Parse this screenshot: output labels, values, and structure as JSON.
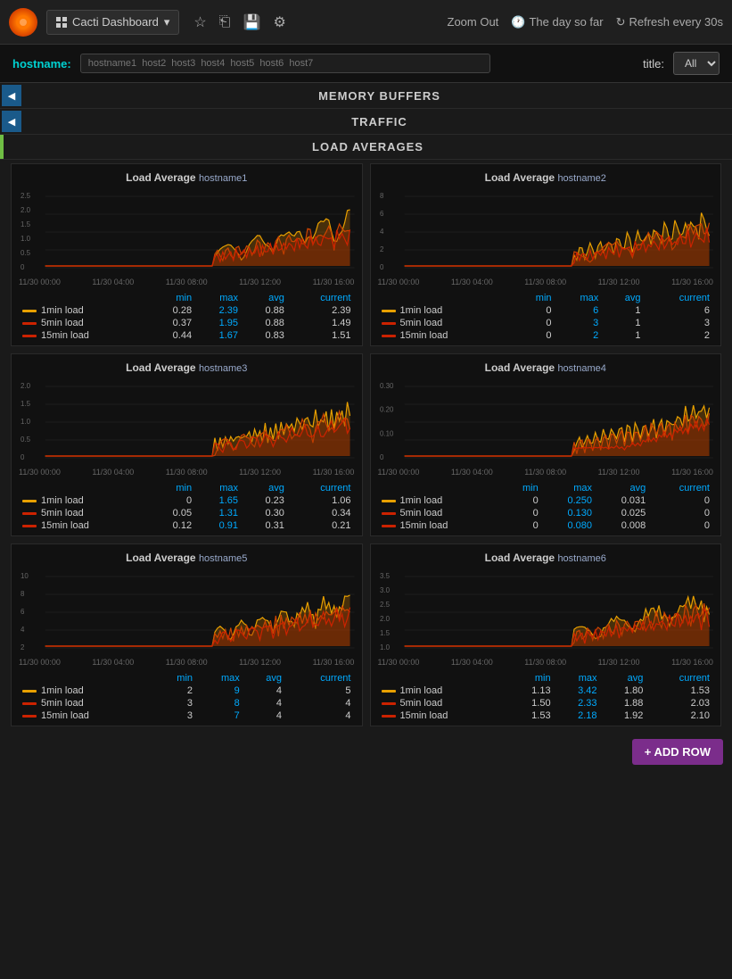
{
  "topbar": {
    "title": "Cacti Dashboard",
    "dropdown_arrow": "▾",
    "icons": [
      "☆",
      "⎋",
      "💾",
      "⚙"
    ],
    "zoom_out": "Zoom Out",
    "time_range": "The day so far",
    "refresh": "Refresh every 30s"
  },
  "filterbar": {
    "hostname_label": "hostname:",
    "hostname_value": "",
    "hostname_placeholder": "hostname1  host2  host3  host4  host5  host6  host7",
    "title_label": "title:",
    "title_value": "All"
  },
  "sections": [
    {
      "label": "MEMORY BUFFERS"
    },
    {
      "label": "TRAFFIC"
    },
    {
      "label": "LOAD AVERAGES"
    }
  ],
  "charts": [
    {
      "id": "chart1",
      "title": "Load Average",
      "hostname": "hostname1",
      "ymax": 2.5,
      "yticks": [
        "2.5",
        "2.0",
        "1.5",
        "1.0",
        "0.5",
        "0"
      ],
      "xLabels": [
        "11/30 00:00",
        "11/30 04:00",
        "11/30 08:00",
        "11/30 12:00",
        "11/30 16:00"
      ],
      "stats": [
        {
          "label": "1min load",
          "color": "#e8a000",
          "min": "0.28",
          "max": "2.39",
          "avg": "0.88",
          "current": "2.39"
        },
        {
          "label": "5min load",
          "color": "#cc2200",
          "min": "0.37",
          "max": "1.95",
          "avg": "0.88",
          "current": "1.49"
        },
        {
          "label": "15min load",
          "color": "#cc2200",
          "min": "0.44",
          "max": "1.67",
          "avg": "0.83",
          "current": "1.51"
        }
      ]
    },
    {
      "id": "chart2",
      "title": "Load Average",
      "hostname": "hostname2",
      "ymax": 8,
      "yticks": [
        "8",
        "6",
        "4",
        "2",
        "0"
      ],
      "xLabels": [
        "11/30 00:00",
        "11/30 04:00",
        "11/30 08:00",
        "11/30 12:00",
        "11/30 16:00"
      ],
      "stats": [
        {
          "label": "1min load",
          "color": "#e8a000",
          "min": "0",
          "max": "6",
          "avg": "1",
          "current": "6"
        },
        {
          "label": "5min load",
          "color": "#cc2200",
          "min": "0",
          "max": "3",
          "avg": "1",
          "current": "3"
        },
        {
          "label": "15min load",
          "color": "#cc2200",
          "min": "0",
          "max": "2",
          "avg": "1",
          "current": "2"
        }
      ]
    },
    {
      "id": "chart3",
      "title": "Load Average",
      "hostname": "hostname3",
      "ymax": 2.0,
      "yticks": [
        "2.0",
        "1.5",
        "1.0",
        "0.5",
        "0"
      ],
      "xLabels": [
        "11/30 00:00",
        "11/30 04:00",
        "11/30 08:00",
        "11/30 12:00",
        "11/30 16:00"
      ],
      "stats": [
        {
          "label": "1min load",
          "color": "#e8a000",
          "min": "0",
          "max": "1.65",
          "avg": "0.23",
          "current": "1.06"
        },
        {
          "label": "5min load",
          "color": "#cc2200",
          "min": "0.05",
          "max": "1.31",
          "avg": "0.30",
          "current": "0.34"
        },
        {
          "label": "15min load",
          "color": "#cc2200",
          "min": "0.12",
          "max": "0.91",
          "avg": "0.31",
          "current": "0.21"
        }
      ]
    },
    {
      "id": "chart4",
      "title": "Load Average",
      "hostname": "hostname4",
      "ymax": 0.3,
      "yticks": [
        "0.30",
        "0.20",
        "0.10",
        "0"
      ],
      "xLabels": [
        "11/30 00:00",
        "11/30 04:00",
        "11/30 08:00",
        "11/30 12:00",
        "11/30 16:00"
      ],
      "stats": [
        {
          "label": "1min load",
          "color": "#e8a000",
          "min": "0",
          "max": "0.250",
          "avg": "0.031",
          "current": "0"
        },
        {
          "label": "5min load",
          "color": "#cc2200",
          "min": "0",
          "max": "0.130",
          "avg": "0.025",
          "current": "0"
        },
        {
          "label": "15min load",
          "color": "#cc2200",
          "min": "0",
          "max": "0.080",
          "avg": "0.008",
          "current": "0"
        }
      ]
    },
    {
      "id": "chart5",
      "title": "Load Average",
      "hostname": "hostname5",
      "ymax": 10,
      "yticks": [
        "10",
        "8",
        "6",
        "4",
        "2"
      ],
      "xLabels": [
        "11/30 00:00",
        "11/30 04:00",
        "11/30 08:00",
        "11/30 12:00",
        "11/30 16:00"
      ],
      "stats": [
        {
          "label": "1min load",
          "color": "#e8a000",
          "min": "2",
          "max": "9",
          "avg": "4",
          "current": "5"
        },
        {
          "label": "5min load",
          "color": "#cc2200",
          "min": "3",
          "max": "8",
          "avg": "4",
          "current": "4"
        },
        {
          "label": "15min load",
          "color": "#cc2200",
          "min": "3",
          "max": "7",
          "avg": "4",
          "current": "4"
        }
      ]
    },
    {
      "id": "chart6",
      "title": "Load Average",
      "hostname": "hostname6",
      "ymax": 3.5,
      "yticks": [
        "3.5",
        "3.0",
        "2.5",
        "2.0",
        "1.5",
        "1.0"
      ],
      "xLabels": [
        "11/30 00:00",
        "11/30 04:00",
        "11/30 08:00",
        "11/30 12:00",
        "11/30 16:00"
      ],
      "stats": [
        {
          "label": "1min load",
          "color": "#e8a000",
          "min": "1.13",
          "max": "3.42",
          "avg": "1.80",
          "current": "1.53"
        },
        {
          "label": "5min load",
          "color": "#cc2200",
          "min": "1.50",
          "max": "2.33",
          "avg": "1.88",
          "current": "2.03"
        },
        {
          "label": "15min load",
          "color": "#cc2200",
          "min": "1.53",
          "max": "2.18",
          "avg": "1.92",
          "current": "2.10"
        }
      ]
    }
  ],
  "add_row_label": "+ ADD ROW",
  "stats_headers": {
    "min": "min",
    "max": "max",
    "avg": "avg",
    "current": "current"
  }
}
